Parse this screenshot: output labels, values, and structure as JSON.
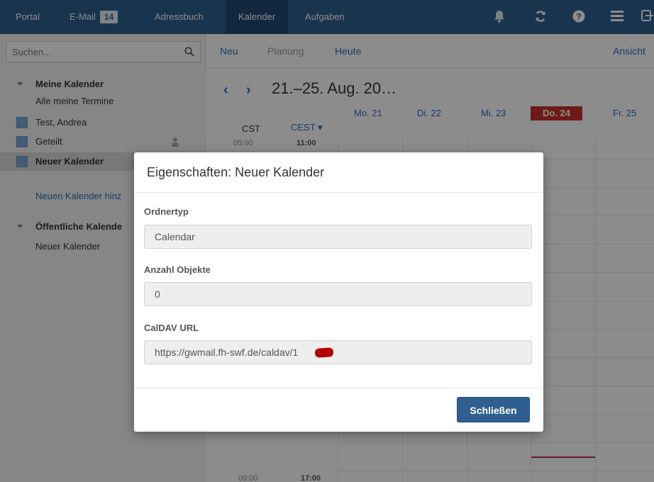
{
  "nav": {
    "tabs": [
      "Portal",
      "E-Mail",
      "Adressbuch",
      "Kalender",
      "Aufgaben"
    ],
    "mail_badge": "14",
    "icons": [
      "bell-icon",
      "refresh-icon",
      "help-icon",
      "menu-icon",
      "logout-icon"
    ]
  },
  "sidebar": {
    "search_placeholder": "Suchen...",
    "my_calendars_header": "Meine Kalender",
    "items": [
      "Alle meine Termine",
      "Test, Andrea",
      "Geteilt",
      "Neuer Kalender"
    ],
    "add_link": "Neuen Kalender hinz",
    "public_header": "Öffentliche Kalende",
    "public_items": [
      "Neuer Kalender"
    ]
  },
  "toolbar": {
    "new": "Neu",
    "planning": "Planung",
    "today": "Heute",
    "view": "Ansicht"
  },
  "calendar": {
    "range": "21.–25. Aug. 20…",
    "days": [
      "Mo. 21",
      "Di. 22",
      "Mi. 23",
      "Do. 24",
      "Fr. 25"
    ],
    "today_index": 3,
    "tz_left": "CST",
    "tz_right": "CEST ▾",
    "time_top_left": "05:00",
    "time_top_right": "11:00",
    "time_bottom_left": "09:00",
    "time_bottom_right": "17:00"
  },
  "modal": {
    "title": "Eigenschaften: Neuer Kalender",
    "folder_type_label": "Ordnertyp",
    "folder_type_value": "Calendar",
    "count_label": "Anzahl Objekte",
    "count_value": "0",
    "caldav_label": "CalDAV URL",
    "caldav_value": "https://gwmail.fh-swf.de/caldav/1",
    "close_label": "Schließen"
  },
  "colors": {
    "nav_bg": "#2f5f8e",
    "link": "#2a6ebb",
    "today": "#c9302c",
    "calendar_swatch": "#7aa7d6"
  }
}
